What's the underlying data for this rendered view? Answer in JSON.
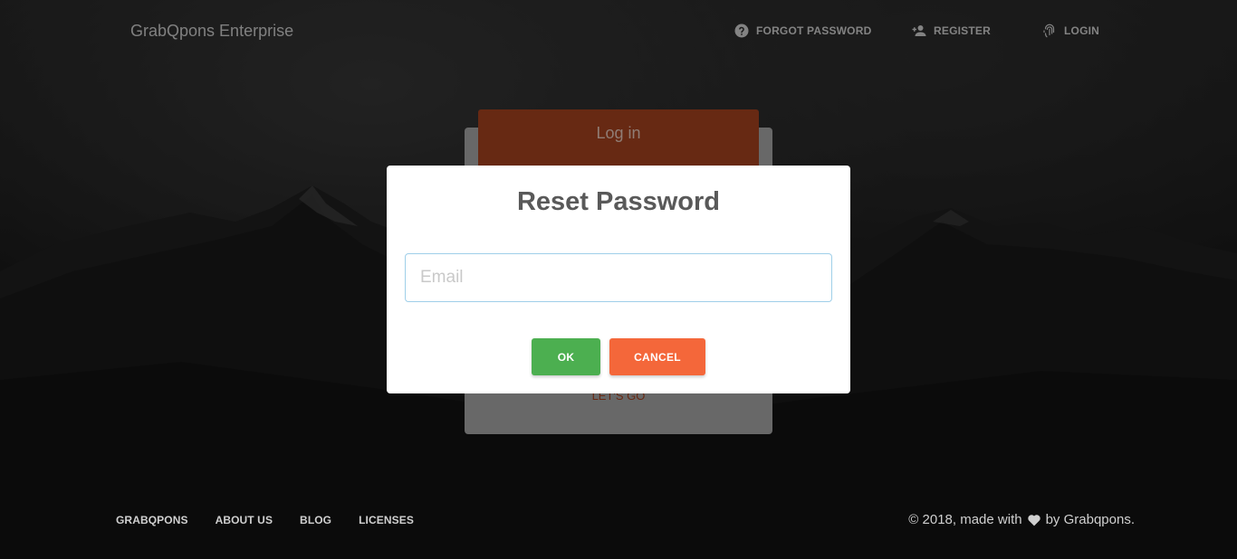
{
  "navbar": {
    "brand": "GrabQpons Enterprise",
    "forgot_password": {
      "label": "FORGOT PASSWORD",
      "icon": "help-circle-icon"
    },
    "register": {
      "label": "REGISTER",
      "icon": "person-add-icon"
    },
    "login": {
      "label": "LOGIN",
      "icon": "fingerprint-icon"
    }
  },
  "login_card": {
    "title": "Log in",
    "action": "LET'S GO",
    "accent": "#a6431f"
  },
  "modal": {
    "title": "Reset Password",
    "email_placeholder": "Email",
    "email_value": "",
    "ok_label": "OK",
    "cancel_label": "CANCEL",
    "ok_color": "#4caf50",
    "cancel_color": "#f4673a"
  },
  "footer": {
    "links": [
      "GRABQPONS",
      "ABOUT US",
      "BLOG",
      "LICENSES"
    ],
    "copyright_prefix": "© 2018, made with",
    "copyright_suffix": "by Grabqpons.",
    "heart_icon": "heart-icon"
  }
}
